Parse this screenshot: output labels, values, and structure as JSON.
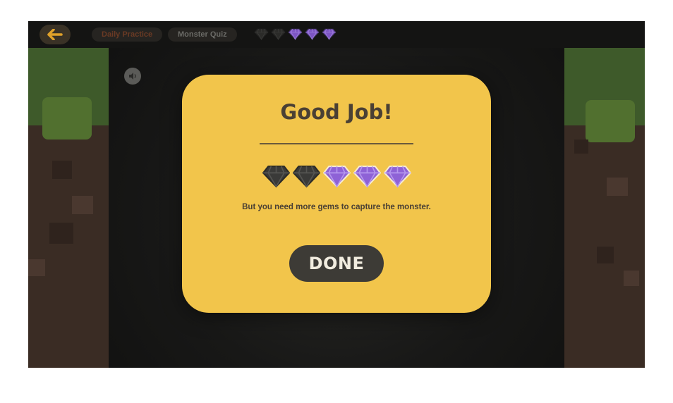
{
  "header": {
    "breadcrumbs": [
      "Daily Practice",
      "Monster Quiz"
    ],
    "gems": [
      "empty",
      "empty",
      "filled",
      "filled",
      "filled"
    ]
  },
  "modal": {
    "title": "Good Job!",
    "gems": [
      "empty",
      "empty",
      "filled",
      "filled",
      "filled"
    ],
    "message": "But you need more gems to capture the monster.",
    "button_label": "DONE"
  },
  "colors": {
    "modal_bg": "#f2c54b",
    "gem_filled": "#8e62d6",
    "gem_empty": "#3a3a38",
    "button_bg": "#3d3b36",
    "back_arrow": "#e0a12a"
  }
}
